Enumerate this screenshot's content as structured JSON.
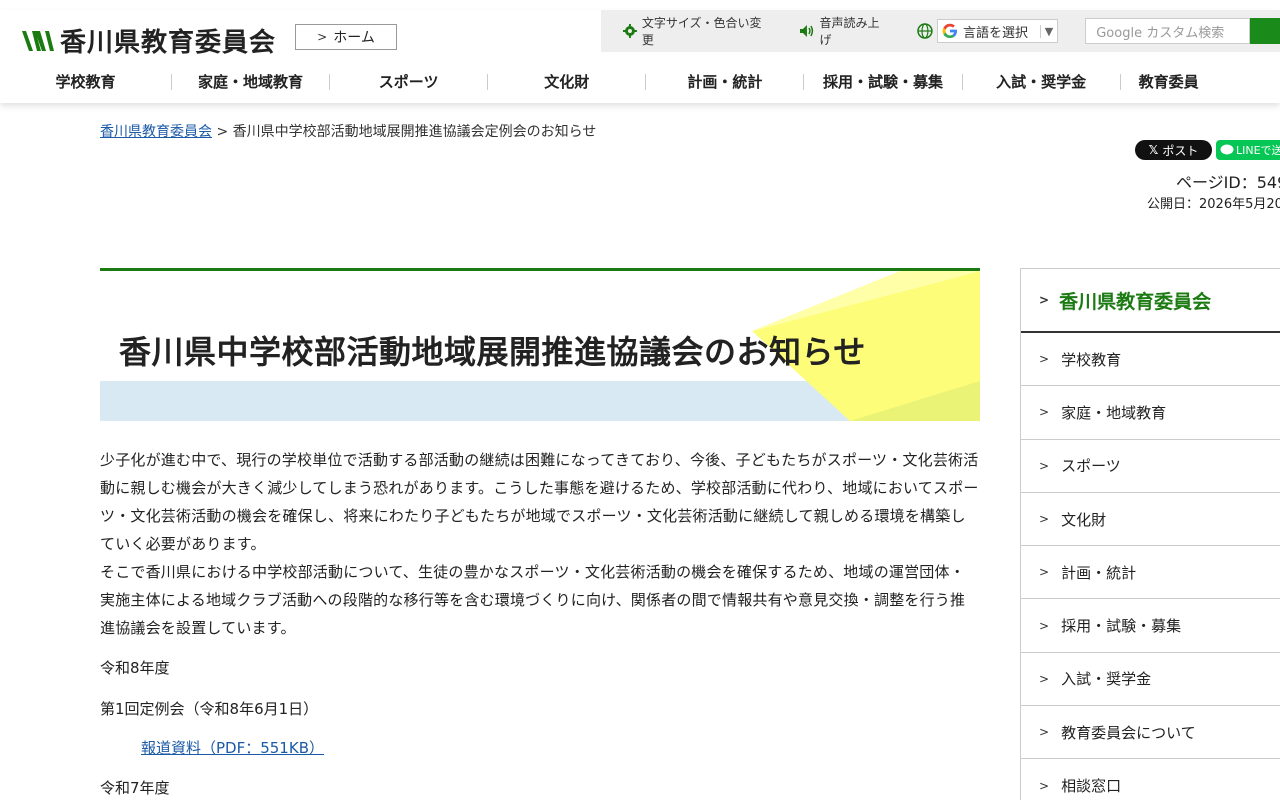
{
  "header": {
    "site_name": "香川県教育委員会",
    "home_label": "ホーム",
    "font_color_label": "文字サイズ・色合い変更",
    "voice_label": "音声読み上げ",
    "lang_label": "言語を選択",
    "lang_arrow": "▼",
    "search_placeholder": "Google カスタム検索",
    "brand_color": "#1b7a12"
  },
  "gnav": [
    "学校教育",
    "家庭・地域教育",
    "スポーツ",
    "文化財",
    "計画・統計",
    "採用・試験・募集",
    "入試・奨学金",
    "教育委員"
  ],
  "breadcrumb": {
    "home_link": "香川県教育委員会",
    "separator": " > ",
    "current": "香川県中学校部活動地域展開推進協議会定例会のお知らせ"
  },
  "share": {
    "x_label": "ポスト",
    "line_label": "LINEで送"
  },
  "meta": {
    "page_id": "ページID：549",
    "published": "公開日：2026年5月20"
  },
  "page_title": "香川県中学校部活動地域展開推進協議会のお知らせ",
  "body": {
    "para1": "少子化が進む中で、現行の学校単位で活動する部活動の継続は困難になってきており、今後、子どもたちがスポーツ・文化芸術活動に親しむ機会が大きく減少してしまう恐れがあります。こうした事態を避けるため、学校部活動に代わり、地域においてスポーツ・文化芸術活動の機会を確保し、将来にわたり子どもたちが地域でスポーツ・文化芸術活動に継続して親しめる環境を構築していく必要があります。",
    "para2": "そこで香川県における中学校部活動について、生徒の豊かなスポーツ・文化芸術活動の機会を確保するため、地域の運営団体・実施主体による地域クラブ活動への段階的な移行等を含む環境づくりに向け、関係者の間で情報共有や意見交換・調整を行う推進協議会を設置しています。",
    "year1": "令和8年度",
    "meeting1": "第1回定例会（令和8年6月1日）",
    "doc1": "報道資料（PDF：551KB）",
    "year2": "令和7年度"
  },
  "sidebar": {
    "head": "香川県教育委員会",
    "items": [
      "学校教育",
      "家庭・地域教育",
      "スポーツ",
      "文化財",
      "計画・統計",
      "採用・試験・募集",
      "入試・奨学金",
      "教育委員会について",
      "相談窓口"
    ]
  }
}
